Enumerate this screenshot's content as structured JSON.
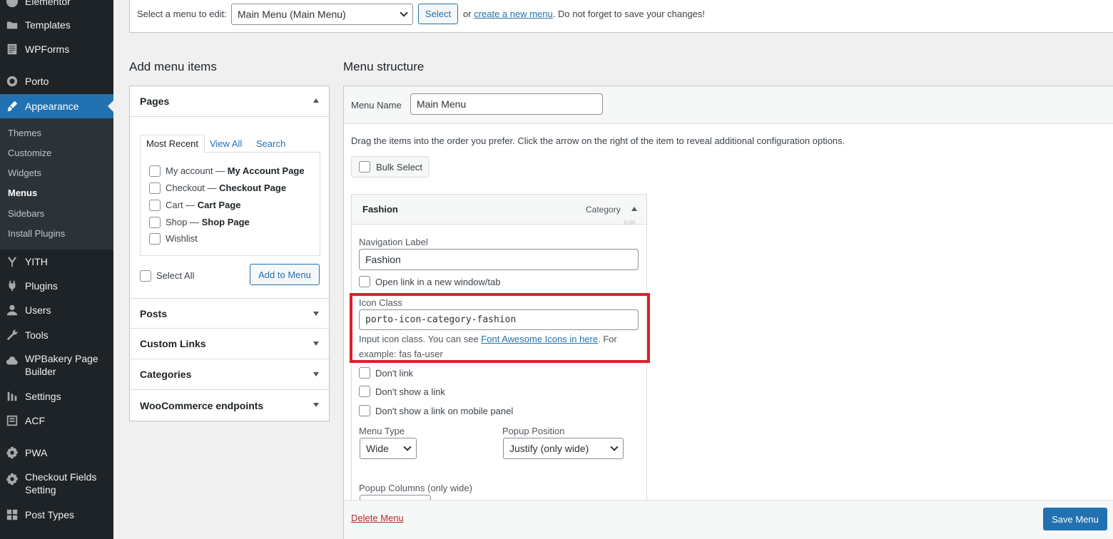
{
  "sidebar": {
    "items": [
      {
        "label": "Elementor",
        "icon": "elementor-icon"
      },
      {
        "label": "Templates",
        "icon": "folder-icon"
      },
      {
        "label": "WPForms",
        "icon": "form-icon"
      },
      {
        "label": "Porto",
        "icon": "porto-icon"
      },
      {
        "label": "Appearance",
        "icon": "paintbrush-icon"
      },
      {
        "label": "YITH",
        "icon": "yith-icon"
      },
      {
        "label": "Plugins",
        "icon": "plug-icon"
      },
      {
        "label": "Users",
        "icon": "user-icon"
      },
      {
        "label": "Tools",
        "icon": "wrench-icon"
      },
      {
        "label": "WPBakery Page",
        "label2": "Builder",
        "icon": "cloud-icon"
      },
      {
        "label": "Settings",
        "icon": "settings-sliders-icon"
      },
      {
        "label": "ACF",
        "icon": "acf-icon"
      },
      {
        "label": "PWA",
        "icon": "gear-icon"
      },
      {
        "label": "Checkout Fields",
        "label2": "Setting",
        "icon": "gear-icon"
      },
      {
        "label": "Post Types",
        "icon": "grid-icon"
      }
    ],
    "submenu": [
      "Themes",
      "Customize",
      "Widgets",
      "Menus",
      "Sidebars",
      "Install Plugins"
    ]
  },
  "topbar": {
    "label": "Select a menu to edit:",
    "selected_menu": "Main Menu (Main Menu)",
    "select_button": "Select",
    "or_text": "or",
    "create_link": "create a new menu",
    "save_note": ". Do not forget to save your changes!"
  },
  "add_items": {
    "heading": "Add menu items",
    "pages": {
      "title": "Pages",
      "tabs": [
        "Most Recent",
        "View All",
        "Search"
      ],
      "items": [
        {
          "title": "My account",
          "sep": " — ",
          "page": "My Account Page"
        },
        {
          "title": "Checkout",
          "sep": " — ",
          "page": "Checkout Page"
        },
        {
          "title": "Cart",
          "sep": " — ",
          "page": "Cart Page"
        },
        {
          "title": "Shop",
          "sep": " — ",
          "page": "Shop Page"
        },
        {
          "title": "Wishlist",
          "sep": "",
          "page": ""
        }
      ],
      "select_all": "Select All",
      "add_button": "Add to Menu"
    },
    "sections": [
      "Posts",
      "Custom Links",
      "Categories",
      "WooCommerce endpoints"
    ]
  },
  "structure": {
    "heading": "Menu structure",
    "menu_name_label": "Menu Name",
    "menu_name_value": "Main Menu",
    "instructions": "Drag the items into the order you prefer. Click the arrow on the right of the item to reveal additional configuration options.",
    "bulk_select": "Bulk Select",
    "item": {
      "title": "Fashion",
      "type": "Category",
      "edit_peek": "Edit",
      "nav_label_label": "Navigation Label",
      "nav_label_value": "Fashion",
      "open_new_tab": "Open link in a new window/tab",
      "icon_class_label": "Icon Class",
      "icon_class_value": "porto-icon-category-fashion",
      "icon_help_pre": "Input icon class. You can see ",
      "icon_help_link": "Font Awesome Icons in here",
      "icon_help_post": ". For",
      "icon_help_line2": "example: fas fa-user",
      "dont_link": "Don't link",
      "dont_show_link": "Don't show a link",
      "dont_show_mobile": "Don't show a link on mobile panel",
      "menu_type_label": "Menu Type",
      "menu_type_value": "Wide",
      "popup_position_label": "Popup Position",
      "popup_position_value": "Justify (only wide)",
      "popup_columns_label": "Popup Columns (only wide)"
    },
    "delete_menu": "Delete Menu",
    "save_menu": "Save Menu"
  }
}
